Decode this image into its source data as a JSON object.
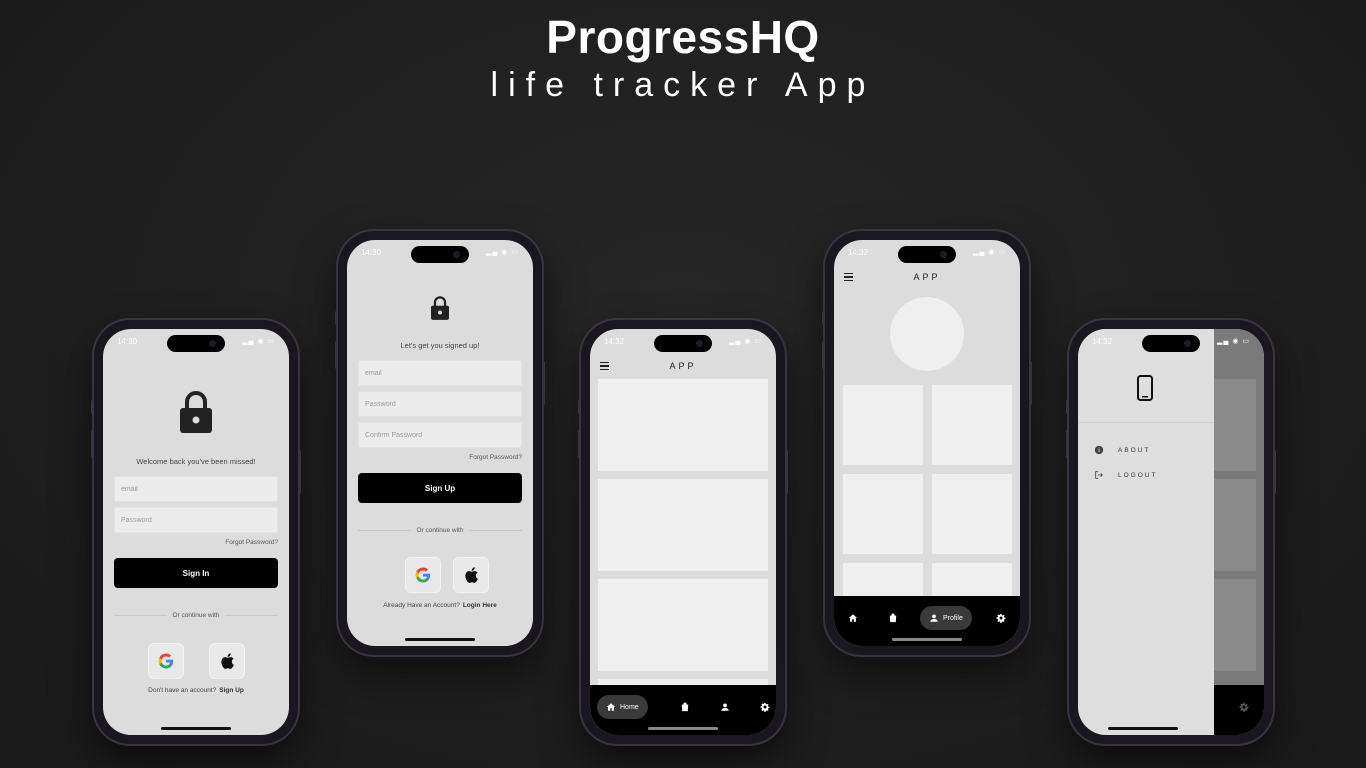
{
  "header": {
    "title": "ProgressHQ",
    "subtitle": "life tracker App"
  },
  "phones": {
    "login": {
      "time": "14:30",
      "welcome": "Welcome back you've been missed!",
      "email_placeholder": "email",
      "password_placeholder": "Password",
      "forgot": "Forgot Password?",
      "signin_label": "Sign In",
      "continue_with": "Or continue with",
      "footer_prefix": "Don't have an account?",
      "footer_link": "Sign Up"
    },
    "signup": {
      "time": "14:30",
      "welcome": "Let's get you signed up!",
      "email_placeholder": "email",
      "password_placeholder": "Password",
      "confirm_placeholder": "Confirm Password",
      "forgot": "Forgot Password?",
      "signup_label": "Sign Up",
      "continue_with": "Or continue with",
      "footer_prefix": "Already Have an Account?",
      "footer_link": "Login Here"
    },
    "home": {
      "time": "14:32",
      "app_title": "APP",
      "nav": {
        "home_label": "Home",
        "active": "home"
      }
    },
    "profile": {
      "time": "14:32",
      "app_title": "APP",
      "nav": {
        "profile_label": "Profile",
        "active": "profile"
      }
    },
    "drawer": {
      "time": "14:32",
      "items": [
        {
          "icon": "info-icon",
          "label": "ABOUT"
        },
        {
          "icon": "logout-icon",
          "label": "LOGOUT"
        }
      ]
    }
  },
  "icons": {
    "lock": "lock-icon",
    "google": "google-icon",
    "apple": "apple-icon",
    "menu": "menu-icon",
    "home": "home-icon",
    "shop": "shopping-bag-icon",
    "person": "person-icon",
    "gear": "gear-icon",
    "device": "smartphone-icon"
  },
  "colors": {
    "background": "#222222",
    "screen": "#dcdcdc",
    "card": "#efefef",
    "primary_button": "#000000",
    "nav_pill": "#3a3a3a"
  }
}
